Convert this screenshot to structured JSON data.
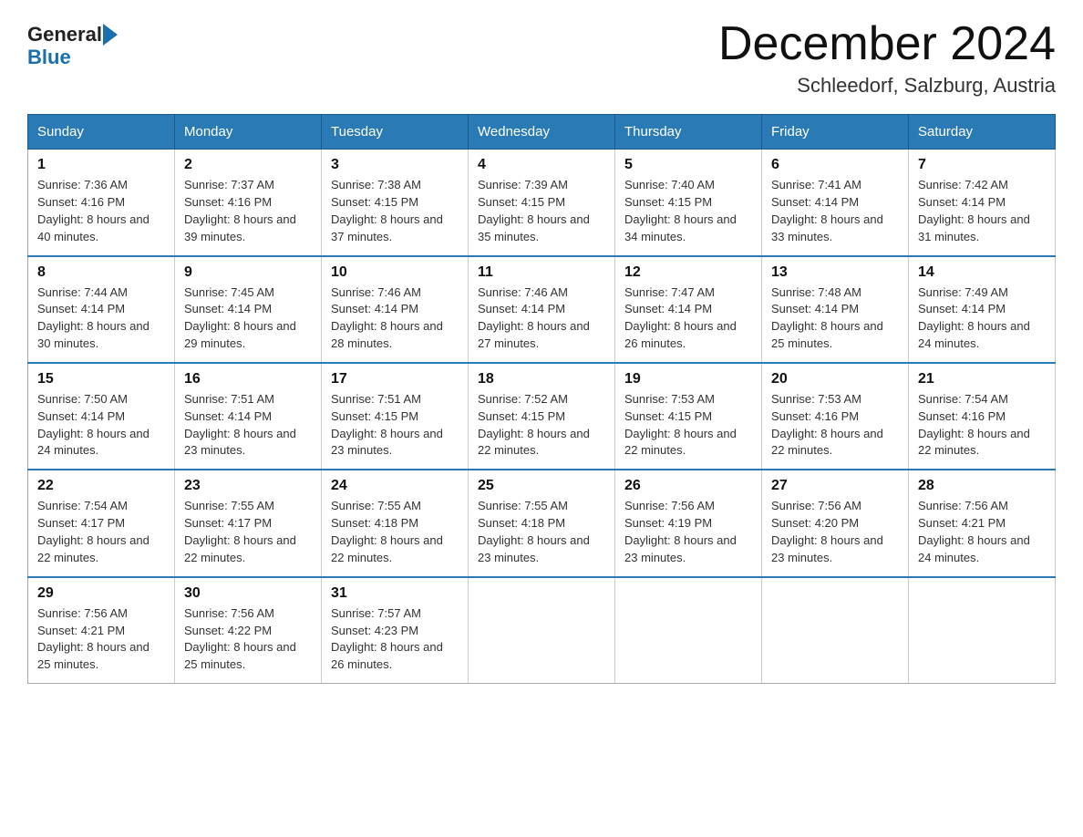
{
  "header": {
    "logo_general": "General",
    "logo_blue": "Blue",
    "month_title": "December 2024",
    "location": "Schleedorf, Salzburg, Austria"
  },
  "weekdays": [
    "Sunday",
    "Monday",
    "Tuesday",
    "Wednesday",
    "Thursday",
    "Friday",
    "Saturday"
  ],
  "weeks": [
    [
      {
        "day": "1",
        "sunrise": "7:36 AM",
        "sunset": "4:16 PM",
        "daylight": "8 hours and 40 minutes."
      },
      {
        "day": "2",
        "sunrise": "7:37 AM",
        "sunset": "4:16 PM",
        "daylight": "8 hours and 39 minutes."
      },
      {
        "day": "3",
        "sunrise": "7:38 AM",
        "sunset": "4:15 PM",
        "daylight": "8 hours and 37 minutes."
      },
      {
        "day": "4",
        "sunrise": "7:39 AM",
        "sunset": "4:15 PM",
        "daylight": "8 hours and 35 minutes."
      },
      {
        "day": "5",
        "sunrise": "7:40 AM",
        "sunset": "4:15 PM",
        "daylight": "8 hours and 34 minutes."
      },
      {
        "day": "6",
        "sunrise": "7:41 AM",
        "sunset": "4:14 PM",
        "daylight": "8 hours and 33 minutes."
      },
      {
        "day": "7",
        "sunrise": "7:42 AM",
        "sunset": "4:14 PM",
        "daylight": "8 hours and 31 minutes."
      }
    ],
    [
      {
        "day": "8",
        "sunrise": "7:44 AM",
        "sunset": "4:14 PM",
        "daylight": "8 hours and 30 minutes."
      },
      {
        "day": "9",
        "sunrise": "7:45 AM",
        "sunset": "4:14 PM",
        "daylight": "8 hours and 29 minutes."
      },
      {
        "day": "10",
        "sunrise": "7:46 AM",
        "sunset": "4:14 PM",
        "daylight": "8 hours and 28 minutes."
      },
      {
        "day": "11",
        "sunrise": "7:46 AM",
        "sunset": "4:14 PM",
        "daylight": "8 hours and 27 minutes."
      },
      {
        "day": "12",
        "sunrise": "7:47 AM",
        "sunset": "4:14 PM",
        "daylight": "8 hours and 26 minutes."
      },
      {
        "day": "13",
        "sunrise": "7:48 AM",
        "sunset": "4:14 PM",
        "daylight": "8 hours and 25 minutes."
      },
      {
        "day": "14",
        "sunrise": "7:49 AM",
        "sunset": "4:14 PM",
        "daylight": "8 hours and 24 minutes."
      }
    ],
    [
      {
        "day": "15",
        "sunrise": "7:50 AM",
        "sunset": "4:14 PM",
        "daylight": "8 hours and 24 minutes."
      },
      {
        "day": "16",
        "sunrise": "7:51 AM",
        "sunset": "4:14 PM",
        "daylight": "8 hours and 23 minutes."
      },
      {
        "day": "17",
        "sunrise": "7:51 AM",
        "sunset": "4:15 PM",
        "daylight": "8 hours and 23 minutes."
      },
      {
        "day": "18",
        "sunrise": "7:52 AM",
        "sunset": "4:15 PM",
        "daylight": "8 hours and 22 minutes."
      },
      {
        "day": "19",
        "sunrise": "7:53 AM",
        "sunset": "4:15 PM",
        "daylight": "8 hours and 22 minutes."
      },
      {
        "day": "20",
        "sunrise": "7:53 AM",
        "sunset": "4:16 PM",
        "daylight": "8 hours and 22 minutes."
      },
      {
        "day": "21",
        "sunrise": "7:54 AM",
        "sunset": "4:16 PM",
        "daylight": "8 hours and 22 minutes."
      }
    ],
    [
      {
        "day": "22",
        "sunrise": "7:54 AM",
        "sunset": "4:17 PM",
        "daylight": "8 hours and 22 minutes."
      },
      {
        "day": "23",
        "sunrise": "7:55 AM",
        "sunset": "4:17 PM",
        "daylight": "8 hours and 22 minutes."
      },
      {
        "day": "24",
        "sunrise": "7:55 AM",
        "sunset": "4:18 PM",
        "daylight": "8 hours and 22 minutes."
      },
      {
        "day": "25",
        "sunrise": "7:55 AM",
        "sunset": "4:18 PM",
        "daylight": "8 hours and 23 minutes."
      },
      {
        "day": "26",
        "sunrise": "7:56 AM",
        "sunset": "4:19 PM",
        "daylight": "8 hours and 23 minutes."
      },
      {
        "day": "27",
        "sunrise": "7:56 AM",
        "sunset": "4:20 PM",
        "daylight": "8 hours and 23 minutes."
      },
      {
        "day": "28",
        "sunrise": "7:56 AM",
        "sunset": "4:21 PM",
        "daylight": "8 hours and 24 minutes."
      }
    ],
    [
      {
        "day": "29",
        "sunrise": "7:56 AM",
        "sunset": "4:21 PM",
        "daylight": "8 hours and 25 minutes."
      },
      {
        "day": "30",
        "sunrise": "7:56 AM",
        "sunset": "4:22 PM",
        "daylight": "8 hours and 25 minutes."
      },
      {
        "day": "31",
        "sunrise": "7:57 AM",
        "sunset": "4:23 PM",
        "daylight": "8 hours and 26 minutes."
      },
      null,
      null,
      null,
      null
    ]
  ]
}
